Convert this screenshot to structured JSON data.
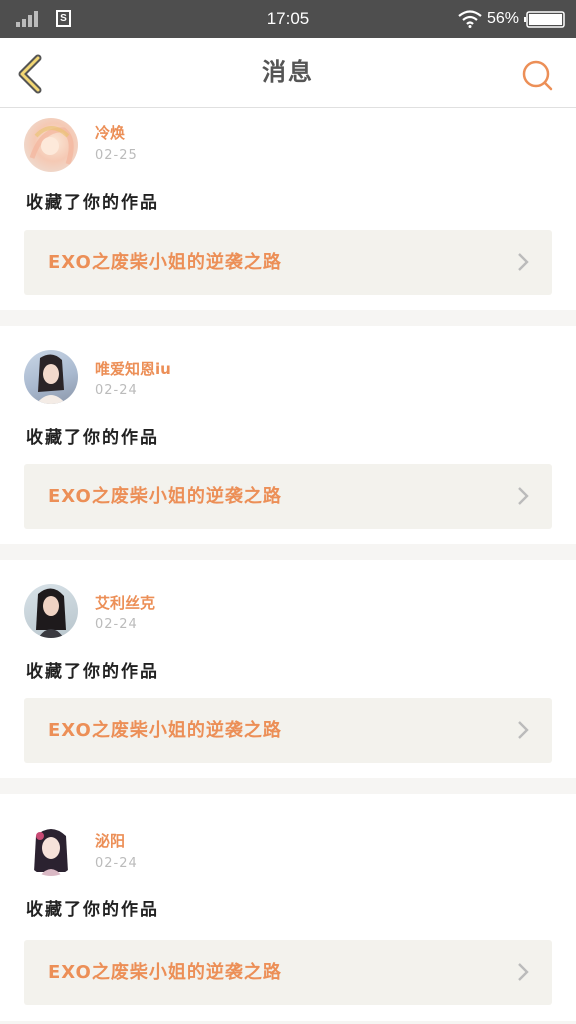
{
  "status_bar": {
    "time": "17:05",
    "battery_percent": "56%"
  },
  "header": {
    "title": "消息"
  },
  "messages": [
    {
      "user": "冷焕",
      "date": "02-25",
      "action": "收藏了你的作品",
      "work_title": "EXO之废柴小姐的逆袭之路"
    },
    {
      "user": "唯爱知恩iu",
      "date": "02-24",
      "action": "收藏了你的作品",
      "work_title": "EXO之废柴小姐的逆袭之路"
    },
    {
      "user": "艾利丝克",
      "date": "02-24",
      "action": "收藏了你的作品",
      "work_title": "EXO之废柴小姐的逆袭之路"
    },
    {
      "user": "泌阳",
      "date": "02-24",
      "action": "收藏了你的作品",
      "work_title": "EXO之废柴小姐的逆袭之路"
    }
  ],
  "colors": {
    "accent": "#ec8f57",
    "status_bar": "#4e4e4e",
    "card_link_bg": "#f3f2ed"
  }
}
